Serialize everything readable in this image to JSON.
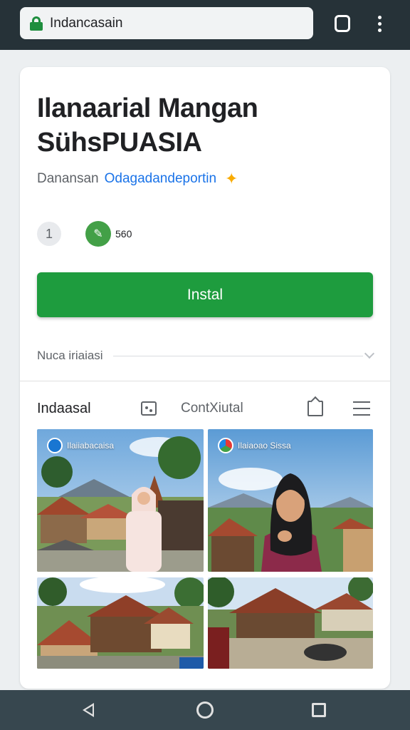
{
  "browser": {
    "url": "Indancasain",
    "tab_count": "",
    "accent": "#263238"
  },
  "app": {
    "title": "Ilanaarial Mangan SühsPUASIA",
    "developer_label": "Danansan",
    "developer_name": "Odagadandeportin",
    "rating": "1",
    "download_count": "560",
    "install_label": "Instal",
    "install_color": "#1e9c3e",
    "notice_text": "Nuca iriaiasi"
  },
  "toolbar": {
    "label": "Indaasal",
    "center_text": "ContXiutal"
  },
  "gallery": {
    "screenshots": [
      {
        "caption": "Ilaiiabacaisa"
      },
      {
        "caption": "Ilaiaoao Sissa"
      },
      {
        "caption": ""
      },
      {
        "caption": ""
      }
    ]
  }
}
